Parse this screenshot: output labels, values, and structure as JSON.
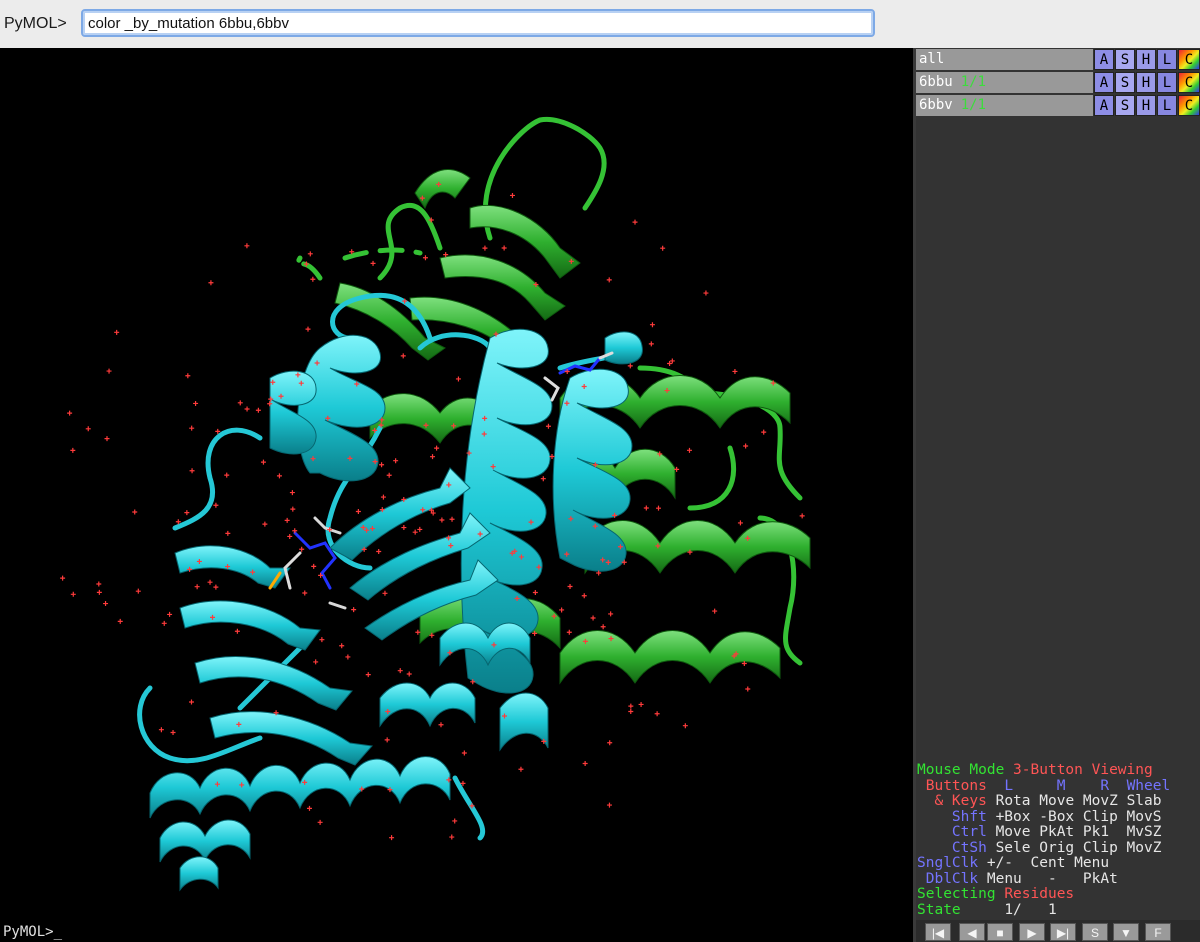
{
  "command": {
    "prompt": "PyMOL>",
    "value": "color _by_mutation 6bbu,6bbv"
  },
  "objects": [
    {
      "name": "all",
      "state": "",
      "buttons": [
        "A",
        "S",
        "H",
        "L",
        "C"
      ]
    },
    {
      "name": "6bbu",
      "state": "1/1",
      "buttons": [
        "A",
        "S",
        "H",
        "L",
        "C"
      ]
    },
    {
      "name": "6bbv",
      "state": "1/1",
      "buttons": [
        "A",
        "S",
        "H",
        "L",
        "C"
      ]
    }
  ],
  "mouse_help": {
    "mode_label": "Mouse Mode",
    "mode_value": "3-Button Viewing",
    "buttons_label": "Buttons",
    "col_l": "L",
    "col_m": "M",
    "col_r": "R",
    "col_wheel": "Wheel",
    "rows": [
      {
        "key": "& Keys",
        "l": "Rota",
        "m": "Move",
        "r": "MovZ",
        "w": "Slab"
      },
      {
        "key": "Shft",
        "l": "+Box",
        "m": "-Box",
        "r": "Clip",
        "w": "MovS"
      },
      {
        "key": "Ctrl",
        "l": "Move",
        "m": "PkAt",
        "r": "Pk1",
        "w": "MvSZ"
      },
      {
        "key": "CtSh",
        "l": "Sele",
        "m": "Orig",
        "r": "Clip",
        "w": "MovZ"
      },
      {
        "key": "SnglClk",
        "l": "+/-",
        "m": "Cent",
        "r": "Menu",
        "w": ""
      },
      {
        "key": "DblClk",
        "l": "Menu",
        "m": "-",
        "r": "PkAt",
        "w": ""
      }
    ],
    "selecting_label": "Selecting",
    "selecting_value": "Residues",
    "state_label": "State",
    "state_value": "1/   1"
  },
  "bottom_prompt": "PyMOL>_",
  "playback": [
    "|◀",
    "◀",
    "■",
    "▶",
    "▶|",
    "S",
    "▼",
    "F"
  ],
  "colors": {
    "viewer_bg": "#000000",
    "chain_cyan": "#22cfdc",
    "chain_green": "#2db32d",
    "water_red": "#ff3030",
    "panel_bg": "#333333"
  }
}
